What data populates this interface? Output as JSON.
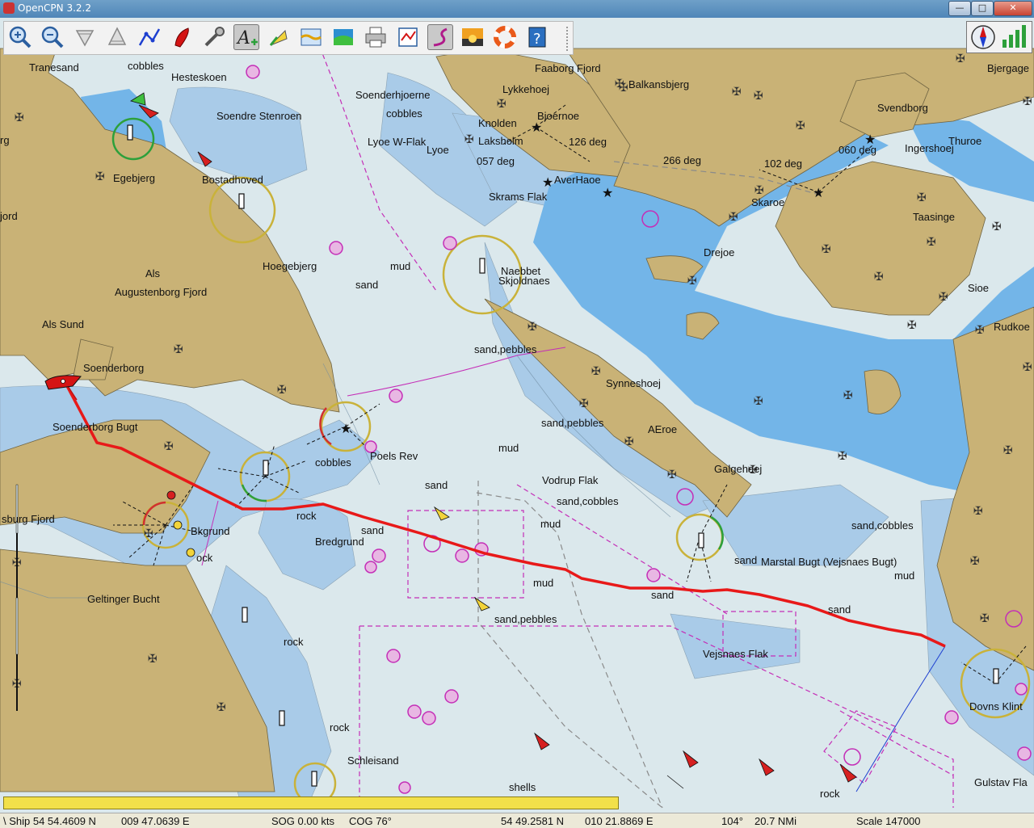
{
  "window": {
    "title": "OpenCPN 3.2.2",
    "minimize": "—",
    "maximize": "□",
    "close": "✕"
  },
  "toolbar": {
    "buttons": [
      {
        "name": "zoom-in",
        "icon": "zoom-in-icon"
      },
      {
        "name": "zoom-out",
        "icon": "zoom-out-icon"
      },
      {
        "name": "scale-down",
        "icon": "scale-down-icon"
      },
      {
        "name": "scale-up",
        "icon": "scale-up-icon"
      },
      {
        "name": "route",
        "icon": "route-icon"
      },
      {
        "name": "auto-follow",
        "icon": "ship-icon"
      },
      {
        "name": "options",
        "icon": "wrench-icon"
      },
      {
        "name": "text",
        "icon": "text-icon"
      },
      {
        "name": "current",
        "icon": "current-icon"
      },
      {
        "name": "tide",
        "icon": "tide-icon"
      },
      {
        "name": "route-manager",
        "icon": "route-manager-icon"
      },
      {
        "name": "print",
        "icon": "print-icon"
      },
      {
        "name": "ais",
        "icon": "ais-icon"
      },
      {
        "name": "track",
        "icon": "track-icon"
      },
      {
        "name": "color-scheme",
        "icon": "sunset-icon"
      },
      {
        "name": "mob",
        "icon": "lifebuoy-icon"
      },
      {
        "name": "help",
        "icon": "help-icon"
      }
    ],
    "active": [
      "text",
      "track"
    ]
  },
  "right_panel": {
    "icons": [
      "compass-icon",
      "gps-signal-icon"
    ]
  },
  "labels": [
    {
      "t": "Tranesand"
    },
    {
      "t": "cobbles"
    },
    {
      "t": "Hesteskoen"
    },
    {
      "t": "Soenderhjoerne"
    },
    {
      "t": "Faaborg Fjord"
    },
    {
      "t": "Balkansbjerg"
    },
    {
      "t": "Bjergage"
    },
    {
      "t": "Lykkehoej"
    },
    {
      "t": "Svendborg"
    },
    {
      "t": "cobbles"
    },
    {
      "t": "Soendre Stenroen"
    },
    {
      "t": "Knolden"
    },
    {
      "t": "Bjoernoe"
    },
    {
      "t": "Laksholm"
    },
    {
      "t": "126 deg"
    },
    {
      "t": "Lyoe W-Flak"
    },
    {
      "t": "Lyoe"
    },
    {
      "t": "060 deg"
    },
    {
      "t": "Ingershoej"
    },
    {
      "t": "Thuroe"
    },
    {
      "t": "rg"
    },
    {
      "t": "057 deg"
    },
    {
      "t": "266 deg"
    },
    {
      "t": "102 deg"
    },
    {
      "t": "Egebjerg"
    },
    {
      "t": "Bostadhoved"
    },
    {
      "t": "AverHaoe"
    },
    {
      "t": "Skrams Flak"
    },
    {
      "t": "Skaroe"
    },
    {
      "t": "Taasinge"
    },
    {
      "t": "jord"
    },
    {
      "t": "mud"
    },
    {
      "t": "Drejoe"
    },
    {
      "t": "Hoegebjerg"
    },
    {
      "t": "Naebbet"
    },
    {
      "t": "Skjoldnaes"
    },
    {
      "t": "Als"
    },
    {
      "t": "sand"
    },
    {
      "t": "Sioe"
    },
    {
      "t": "Augustenborg Fjord"
    },
    {
      "t": "Als Sund"
    },
    {
      "t": "Rudkoe"
    },
    {
      "t": "sand,pebbles"
    },
    {
      "t": "Soenderborg"
    },
    {
      "t": "Synneshoej"
    },
    {
      "t": "sand,pebbles"
    },
    {
      "t": "Soenderborg Bugt"
    },
    {
      "t": "AEroe"
    },
    {
      "t": "mud"
    },
    {
      "t": "Poels Rev"
    },
    {
      "t": "cobbles"
    },
    {
      "t": "Galgehoej"
    },
    {
      "t": "Vodrup Flak"
    },
    {
      "t": "sand"
    },
    {
      "t": "sand,cobbles"
    },
    {
      "t": "sburg Fjord"
    },
    {
      "t": "rock"
    },
    {
      "t": "mud"
    },
    {
      "t": "sand"
    },
    {
      "t": "sand,cobbles"
    },
    {
      "t": "Bredgrund"
    },
    {
      "t": "Bkgrund"
    },
    {
      "t": "ock"
    },
    {
      "t": "sand"
    },
    {
      "t": "Marstal Bugt (Vejsnaes Bugt)"
    },
    {
      "t": "mud"
    },
    {
      "t": "mud"
    },
    {
      "t": "Geltinger Bucht"
    },
    {
      "t": "sand"
    },
    {
      "t": "sand"
    },
    {
      "t": "sand,pebbles"
    },
    {
      "t": "rock"
    },
    {
      "t": "Vejsnaes Flak"
    },
    {
      "t": "Dovns Klint"
    },
    {
      "t": "rock"
    },
    {
      "t": "Schleisand"
    },
    {
      "t": "shells"
    },
    {
      "t": "rock"
    },
    {
      "t": "Gulstav Fla"
    }
  ],
  "status": {
    "ship": "\\ Ship 54 54.4609 N",
    "ship_lon": "009 47.0639 E",
    "sog": "SOG 0.00 kts",
    "cog": "COG 76°",
    "cursor_lat": "54 49.2581 N",
    "cursor_lon": "010 21.8869 E",
    "bearing": "104°",
    "distance": "20.7 NMi",
    "scale": "Scale 147000"
  },
  "colors": {
    "land": "#c9b276",
    "deep_water": "#73b5e8",
    "shallow_water": "#a9cbe8",
    "open_water": "#dbe8ec",
    "track": "#e81919",
    "magenta": "#c42eb7",
    "progress_fill": "#f2e04a"
  }
}
